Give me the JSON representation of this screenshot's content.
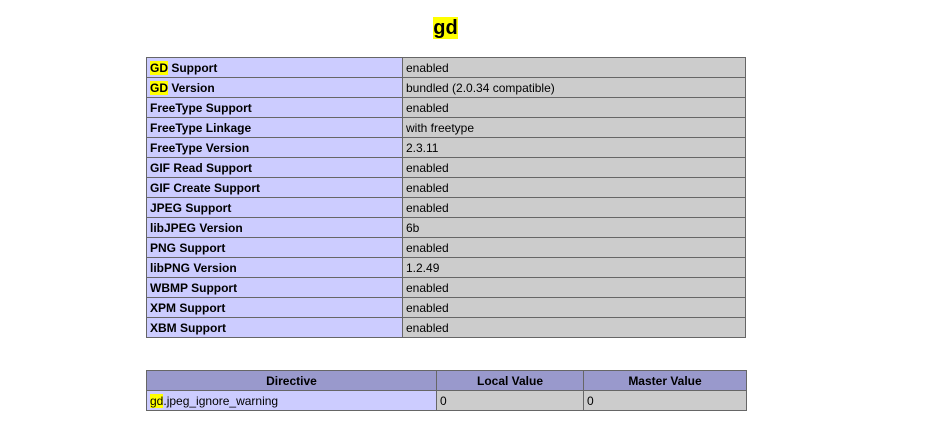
{
  "title": {
    "highlight": "gd"
  },
  "rows": [
    {
      "prefix": "GD",
      "label": " Support",
      "value": "enabled"
    },
    {
      "prefix": "GD",
      "label": " Version",
      "value": "bundled (2.0.34 compatible)"
    },
    {
      "prefix": "",
      "label": "FreeType Support",
      "value": "enabled"
    },
    {
      "prefix": "",
      "label": "FreeType Linkage",
      "value": "with freetype"
    },
    {
      "prefix": "",
      "label": "FreeType Version",
      "value": "2.3.11"
    },
    {
      "prefix": "",
      "label": "GIF Read Support",
      "value": "enabled"
    },
    {
      "prefix": "",
      "label": "GIF Create Support",
      "value": "enabled"
    },
    {
      "prefix": "",
      "label": "JPEG Support",
      "value": "enabled"
    },
    {
      "prefix": "",
      "label": "libJPEG Version",
      "value": "6b"
    },
    {
      "prefix": "",
      "label": "PNG Support",
      "value": "enabled"
    },
    {
      "prefix": "",
      "label": "libPNG Version",
      "value": "1.2.49"
    },
    {
      "prefix": "",
      "label": "WBMP Support",
      "value": "enabled"
    },
    {
      "prefix": "",
      "label": "XPM Support",
      "value": "enabled"
    },
    {
      "prefix": "",
      "label": "XBM Support",
      "value": "enabled"
    }
  ],
  "directives": {
    "headers": [
      "Directive",
      "Local Value",
      "Master Value"
    ],
    "rows": [
      {
        "prefix": "gd",
        "name": ".jpeg_ignore_warning",
        "local": "0",
        "master": "0"
      }
    ]
  },
  "colors": {
    "highlight": "#ffff00",
    "label_cell": "#ccccff",
    "value_cell": "#cccccc",
    "header_cell": "#9999cc",
    "border": "#666666"
  }
}
